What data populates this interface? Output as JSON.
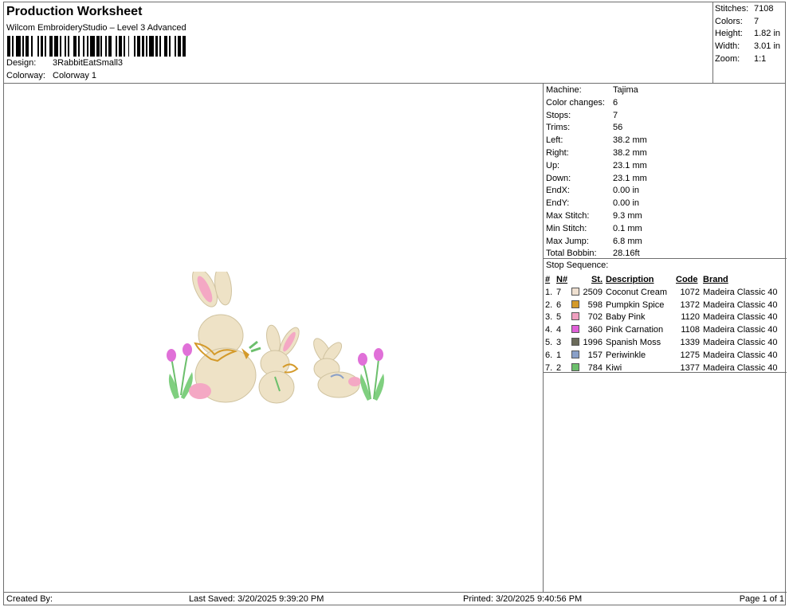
{
  "header": {
    "title": "Production Worksheet",
    "subtitle": "Wilcom EmbroideryStudio – Level 3 Advanced",
    "design_label": "Design:",
    "design_value": "3RabbitEatSmall3",
    "colorway_label": "Colorway:",
    "colorway_value": "Colorway 1"
  },
  "summary": [
    {
      "label": "Stitches:",
      "value": "7108"
    },
    {
      "label": "Colors:",
      "value": "7"
    },
    {
      "label": "Height:",
      "value": "1.82 in"
    },
    {
      "label": "Width:",
      "value": "3.01 in"
    },
    {
      "label": "Zoom:",
      "value": "1:1"
    }
  ],
  "stats": [
    {
      "label": "Machine:",
      "value": "Tajima"
    },
    {
      "label": "Color changes:",
      "value": "6"
    },
    {
      "label": "Stops:",
      "value": "7"
    },
    {
      "label": "Trims:",
      "value": "56"
    },
    {
      "label": "Left:",
      "value": "38.2 mm"
    },
    {
      "label": "Right:",
      "value": "38.2 mm"
    },
    {
      "label": "Up:",
      "value": "23.1 mm"
    },
    {
      "label": "Down:",
      "value": "23.1 mm"
    },
    {
      "label": "EndX:",
      "value": "0.00 in"
    },
    {
      "label": "EndY:",
      "value": "0.00 in"
    },
    {
      "label": "Max Stitch:",
      "value": "9.3 mm"
    },
    {
      "label": "Min Stitch:",
      "value": "0.1 mm"
    },
    {
      "label": "Max Jump:",
      "value": "6.8 mm"
    },
    {
      "label": "Total Bobbin:",
      "value": "28.16ft"
    }
  ],
  "stop_sequence": {
    "caption": "Stop Sequence:",
    "headers": {
      "num": "#",
      "n": "N#",
      "st": "St.",
      "desc": "Description",
      "code": "Code",
      "brand": "Brand"
    },
    "rows": [
      {
        "num": "1.",
        "n": "7",
        "color": "#efe0d0",
        "st": "2509",
        "desc": "Coconut Cream",
        "code": "1072",
        "brand": "Madeira Classic 40"
      },
      {
        "num": "2.",
        "n": "6",
        "color": "#d49a2a",
        "st": "598",
        "desc": "Pumpkin Spice",
        "code": "1372",
        "brand": "Madeira Classic 40"
      },
      {
        "num": "3.",
        "n": "5",
        "color": "#f0a0c0",
        "st": "702",
        "desc": "Baby Pink",
        "code": "1120",
        "brand": "Madeira Classic 40"
      },
      {
        "num": "4.",
        "n": "4",
        "color": "#e060d8",
        "st": "360",
        "desc": "Pink Carnation",
        "code": "1108",
        "brand": "Madeira Classic 40"
      },
      {
        "num": "5.",
        "n": "3",
        "color": "#6b6b5a",
        "st": "1996",
        "desc": "Spanish Moss",
        "code": "1339",
        "brand": "Madeira Classic 40"
      },
      {
        "num": "6.",
        "n": "1",
        "color": "#8aa0c8",
        "st": "157",
        "desc": "Periwinkle",
        "code": "1275",
        "brand": "Madeira Classic 40"
      },
      {
        "num": "7.",
        "n": "2",
        "color": "#6cbf6c",
        "st": "784",
        "desc": "Kiwi",
        "code": "1377",
        "brand": "Madeira Classic 40"
      }
    ]
  },
  "footer": {
    "created_by": "Created By:",
    "last_saved": "Last Saved: 3/20/2025 9:39:20 PM",
    "printed": "Printed: 3/20/2025 9:40:56 PM",
    "page": "Page 1 of 1"
  }
}
